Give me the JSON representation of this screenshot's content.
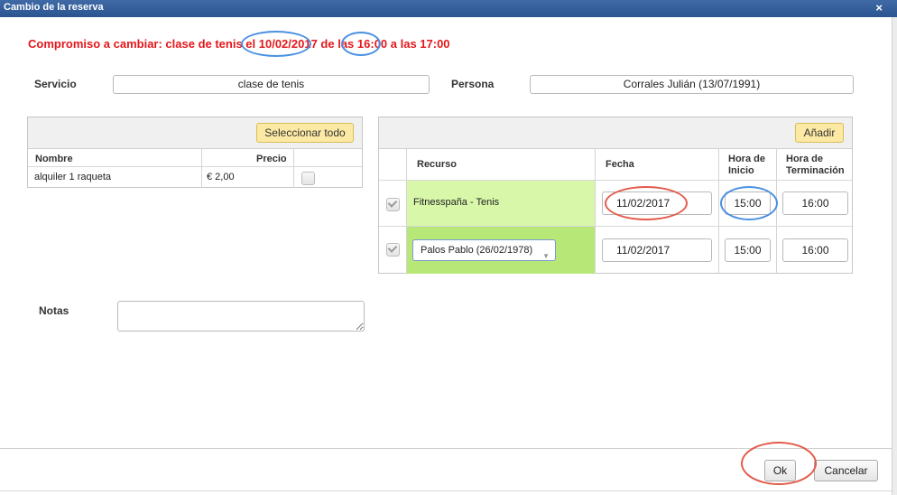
{
  "dialog": {
    "title": "Cambio de la reserva",
    "close_glyph": "×"
  },
  "headline": "Compromiso a cambiar: clase de tenis el 10/02/2017 de las 16:00 a las 17:00",
  "servicio": {
    "label": "Servicio",
    "value": "clase de tenis"
  },
  "persona": {
    "label": "Persona",
    "value": "Corrales Julián (13/07/1991)"
  },
  "left_panel": {
    "select_all_label": "Seleccionar todo",
    "columns": [
      "Nombre",
      "Precio"
    ],
    "rows": [
      {
        "nombre": "alquiler 1 raqueta",
        "precio": "€ 2,00",
        "checked": false
      }
    ]
  },
  "right_panel": {
    "add_label": "Añadir",
    "columns": {
      "recurso": "Recurso",
      "fecha": "Fecha",
      "hora_inicio_1": "Hora de",
      "hora_inicio_2": "Inicio",
      "hora_fin_1": "Hora de",
      "hora_fin_2": "Terminación"
    },
    "rows": [
      {
        "recurso": "Fitnesspaña - Tenis",
        "fecha": "11/02/2017",
        "inicio": "15:00",
        "fin": "16:00"
      },
      {
        "recurso": "Palos Pablo (26/02/1978)",
        "fecha": "11/02/2017",
        "inicio": "15:00",
        "fin": "16:00"
      }
    ],
    "row_bg_1": "#d8f7a9",
    "row_bg_2": "#b7e777"
  },
  "notas": {
    "label": "Notas",
    "value": ""
  },
  "footer": {
    "ok_label": "Ok",
    "cancel_label": "Cancelar"
  },
  "colors": {
    "title_bar": "#2f5a96",
    "headline": "#e4171b",
    "highlight_red": "#e35a4a",
    "highlight_blue": "#4a90e2"
  }
}
